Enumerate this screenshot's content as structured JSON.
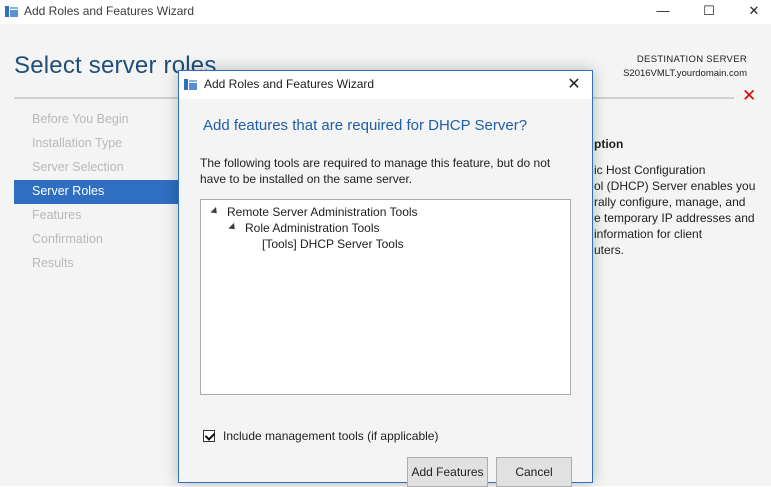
{
  "window": {
    "title": "Add Roles and Features Wizard",
    "controls": {
      "minimize": "—",
      "maximize": "☐",
      "close": "✕"
    }
  },
  "page": {
    "title": "Select server roles"
  },
  "destination": {
    "label": "DESTINATION SERVER",
    "server": "S2016VMLT.yourdomain.com"
  },
  "nav": {
    "items": [
      {
        "label": "Before You Begin",
        "active": false
      },
      {
        "label": "Installation Type",
        "active": false
      },
      {
        "label": "Server Selection",
        "active": false
      },
      {
        "label": "Server Roles",
        "active": true
      },
      {
        "label": "Features",
        "active": false
      },
      {
        "label": "Confirmation",
        "active": false
      },
      {
        "label": "Results",
        "active": false
      }
    ]
  },
  "description": {
    "title": "ption",
    "lines": [
      "ic Host Configuration",
      "ol (DHCP) Server enables you",
      "rally configure, manage, and",
      "e temporary IP addresses and",
      " information for client",
      "uters."
    ]
  },
  "dialog": {
    "title": "Add Roles and Features Wizard",
    "close": "✕",
    "heading": "Add features that are required for DHCP Server?",
    "text_line1": "The following tools are required to manage this feature, but do not",
    "text_line2": "have to be installed on the same server.",
    "tree": {
      "item1": "Remote Server Administration Tools",
      "item2": "Role Administration Tools",
      "item3": "[Tools] DHCP Server Tools"
    },
    "checkbox_label": "Include management tools (if applicable)",
    "checkbox_checked": true,
    "add_button": "Add Features",
    "cancel_button": "Cancel"
  },
  "colors": {
    "accent": "#2e6fc2",
    "title_blue": "#1f4e79",
    "error_red": "#e00000"
  }
}
